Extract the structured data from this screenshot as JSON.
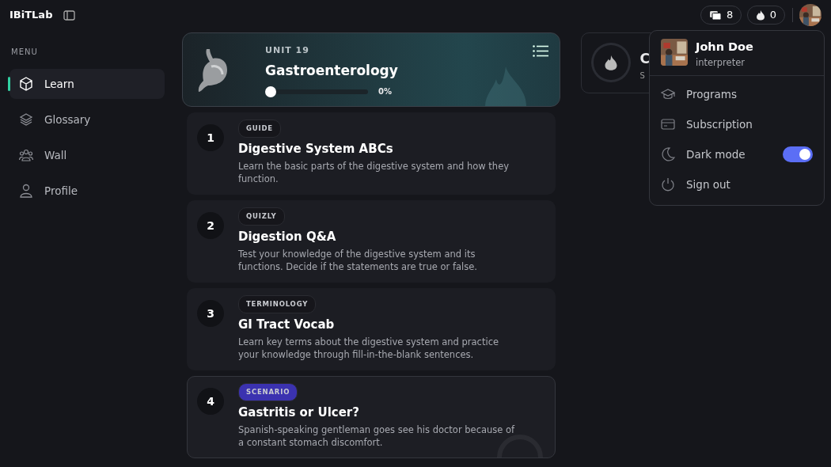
{
  "brand": "IBiTLab",
  "sidebar": {
    "heading": "MENU",
    "items": [
      {
        "label": "Learn",
        "selected": true
      },
      {
        "label": "Glossary",
        "selected": false
      },
      {
        "label": "Wall",
        "selected": false
      },
      {
        "label": "Profile",
        "selected": false
      }
    ]
  },
  "topbar": {
    "cards_count": "8",
    "streak_count": "0"
  },
  "unit": {
    "label": "UNIT 19",
    "title": "Gastroenterology",
    "level": 0,
    "reading": "0%"
  },
  "side_card": {
    "title": "C",
    "subtitle": "S"
  },
  "lessons": [
    {
      "number": "1",
      "tag": "GUIDE",
      "color": "#16161b",
      "title": "Digestive System ABCs",
      "description": "Learn the basic parts of the digestive system and how they function.",
      "selected": false
    },
    {
      "number": "2",
      "tag": "QUIZLY",
      "color": "#16161b",
      "title": "Digestion Q&A",
      "description": "Test your knowledge of the digestive system and its functions. Decide if the statements are true or false.",
      "selected": false
    },
    {
      "number": "3",
      "tag": "TERMINOLOGY",
      "color": "#16161b",
      "title": "GI Tract Vocab",
      "description": "Learn key terms about the digestive system and practice your knowledge through fill-in-the-blank sentences.",
      "selected": false
    },
    {
      "number": "4",
      "tag": "SCENARIO",
      "color": "#3b32b0",
      "title": "Gastritis or Ulcer?",
      "description": "Spanish-speaking gentleman goes see his doctor because of a constant stomach discomfort.",
      "selected": true
    }
  ],
  "user_menu": {
    "name": "John Doe",
    "role": "interpreter",
    "items": [
      {
        "label": "Programs",
        "kind": "link"
      },
      {
        "label": "Subscription",
        "kind": "link"
      },
      {
        "label": "Dark mode",
        "kind": "toggle",
        "on": true
      },
      {
        "label": "Sign out",
        "kind": "link"
      }
    ]
  }
}
